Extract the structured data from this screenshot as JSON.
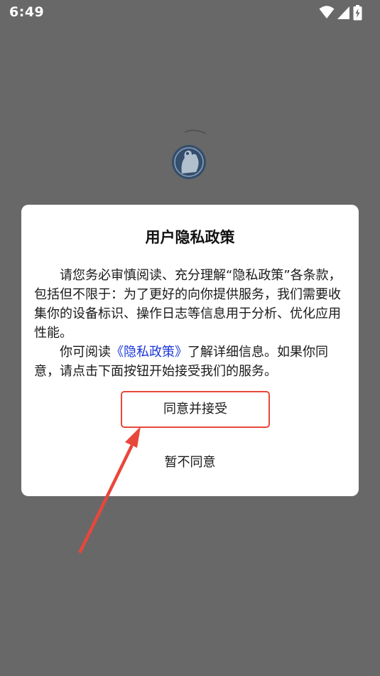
{
  "status_bar": {
    "time": "6:49",
    "icons": [
      "wifi-icon",
      "signal-icon",
      "battery-charging-icon"
    ]
  },
  "splash": {
    "logo_icon": "camel-logo-icon"
  },
  "dialog": {
    "title": "用户隐私政策",
    "paragraph1": "请您务必审慎阅读、充分理解“隐私政策”各条款，包括但不限于：为了更好的向你提供服务，我们需要收集你的设备标识、操作日志等信息用于分析、优化应用性能。",
    "paragraph2_prefix": "你可阅读",
    "policy_link": "《隐私政策》",
    "paragraph2_suffix": "了解详细信息。如果你同意，请点击下面按钮开始接受我们的服务。",
    "agree_label": "同意并接受",
    "decline_label": "暂不同意"
  },
  "colors": {
    "overlay": "#686868",
    "dialog_bg": "#ffffff",
    "link": "#1a36d8",
    "annotation_red": "#e8473b",
    "logo_blue": "#2b4a6e"
  }
}
